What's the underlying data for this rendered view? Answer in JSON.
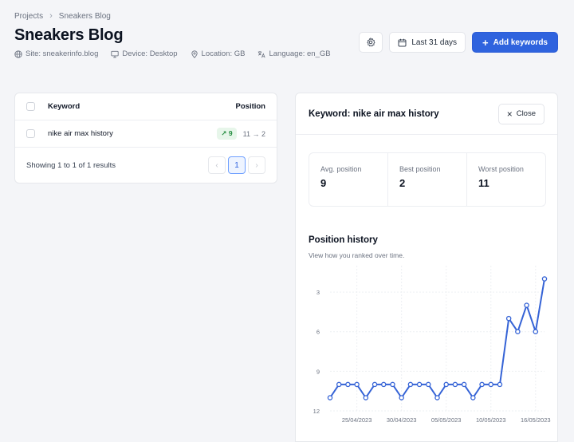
{
  "breadcrumb": {
    "parent": "Projects",
    "current": "Sneakers Blog"
  },
  "page": {
    "title": "Sneakers Blog"
  },
  "meta": {
    "site": "Site: sneakerinfo.blog",
    "device": "Device: Desktop",
    "location": "Location: GB",
    "language": "Language: en_GB"
  },
  "actions": {
    "date_range": "Last 31 days",
    "add_keywords": "Add keywords"
  },
  "keywords_table": {
    "columns": {
      "keyword": "Keyword",
      "position": "Position"
    },
    "rows": [
      {
        "keyword": "nike air max history",
        "delta": "↗ 9",
        "change": "11 → 2"
      }
    ],
    "footer": "Showing 1 to 1 of 1 results",
    "pager": {
      "prev": "‹",
      "page": "1",
      "next": "›"
    }
  },
  "detail": {
    "title": "Keyword: nike air max history",
    "close": "Close",
    "stats": [
      {
        "label": "Avg. position",
        "value": "9"
      },
      {
        "label": "Best position",
        "value": "2"
      },
      {
        "label": "Worst position",
        "value": "11"
      }
    ],
    "history_title": "Position history",
    "history_subtitle": "View how you ranked over time."
  },
  "chart_data": {
    "type": "line",
    "ylim": [
      12,
      1
    ],
    "y_inverted": true,
    "y_ticks": [
      3,
      6,
      9,
      12
    ],
    "x_tick_labels": [
      "25/04/2023",
      "30/04/2023",
      "05/05/2023",
      "10/05/2023",
      "16/05/2023"
    ],
    "x_tick_index": [
      3,
      8,
      13,
      18,
      23
    ],
    "series": [
      {
        "values": [
          11,
          10,
          10,
          10,
          11,
          10,
          10,
          10,
          11,
          10,
          10,
          10,
          11,
          10,
          10,
          10,
          11,
          10,
          10,
          10,
          5,
          6,
          4,
          6,
          2
        ]
      }
    ],
    "grid": true,
    "line_color": "#3563d6"
  }
}
